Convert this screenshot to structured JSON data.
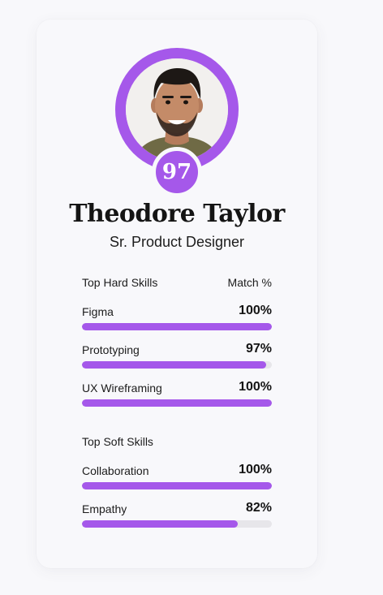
{
  "profile": {
    "score": "97",
    "name": "Theodore Taylor",
    "role": "Sr. Product Designer"
  },
  "hard_skills": {
    "title": "Top Hard Skills",
    "match_label": "Match %",
    "items": [
      {
        "name": "Figma",
        "percent_label": "100%",
        "value": 100
      },
      {
        "name": "Prototyping",
        "percent_label": "97%",
        "value": 97
      },
      {
        "name": "UX Wireframing",
        "percent_label": "100%",
        "value": 100
      }
    ]
  },
  "soft_skills": {
    "title": "Top Soft Skills",
    "items": [
      {
        "name": "Collaboration",
        "percent_label": "100%",
        "value": 100
      },
      {
        "name": "Empathy",
        "percent_label": "82%",
        "value": 82
      }
    ]
  },
  "colors": {
    "accent": "#a558ea",
    "track": "#e7e6ea"
  }
}
